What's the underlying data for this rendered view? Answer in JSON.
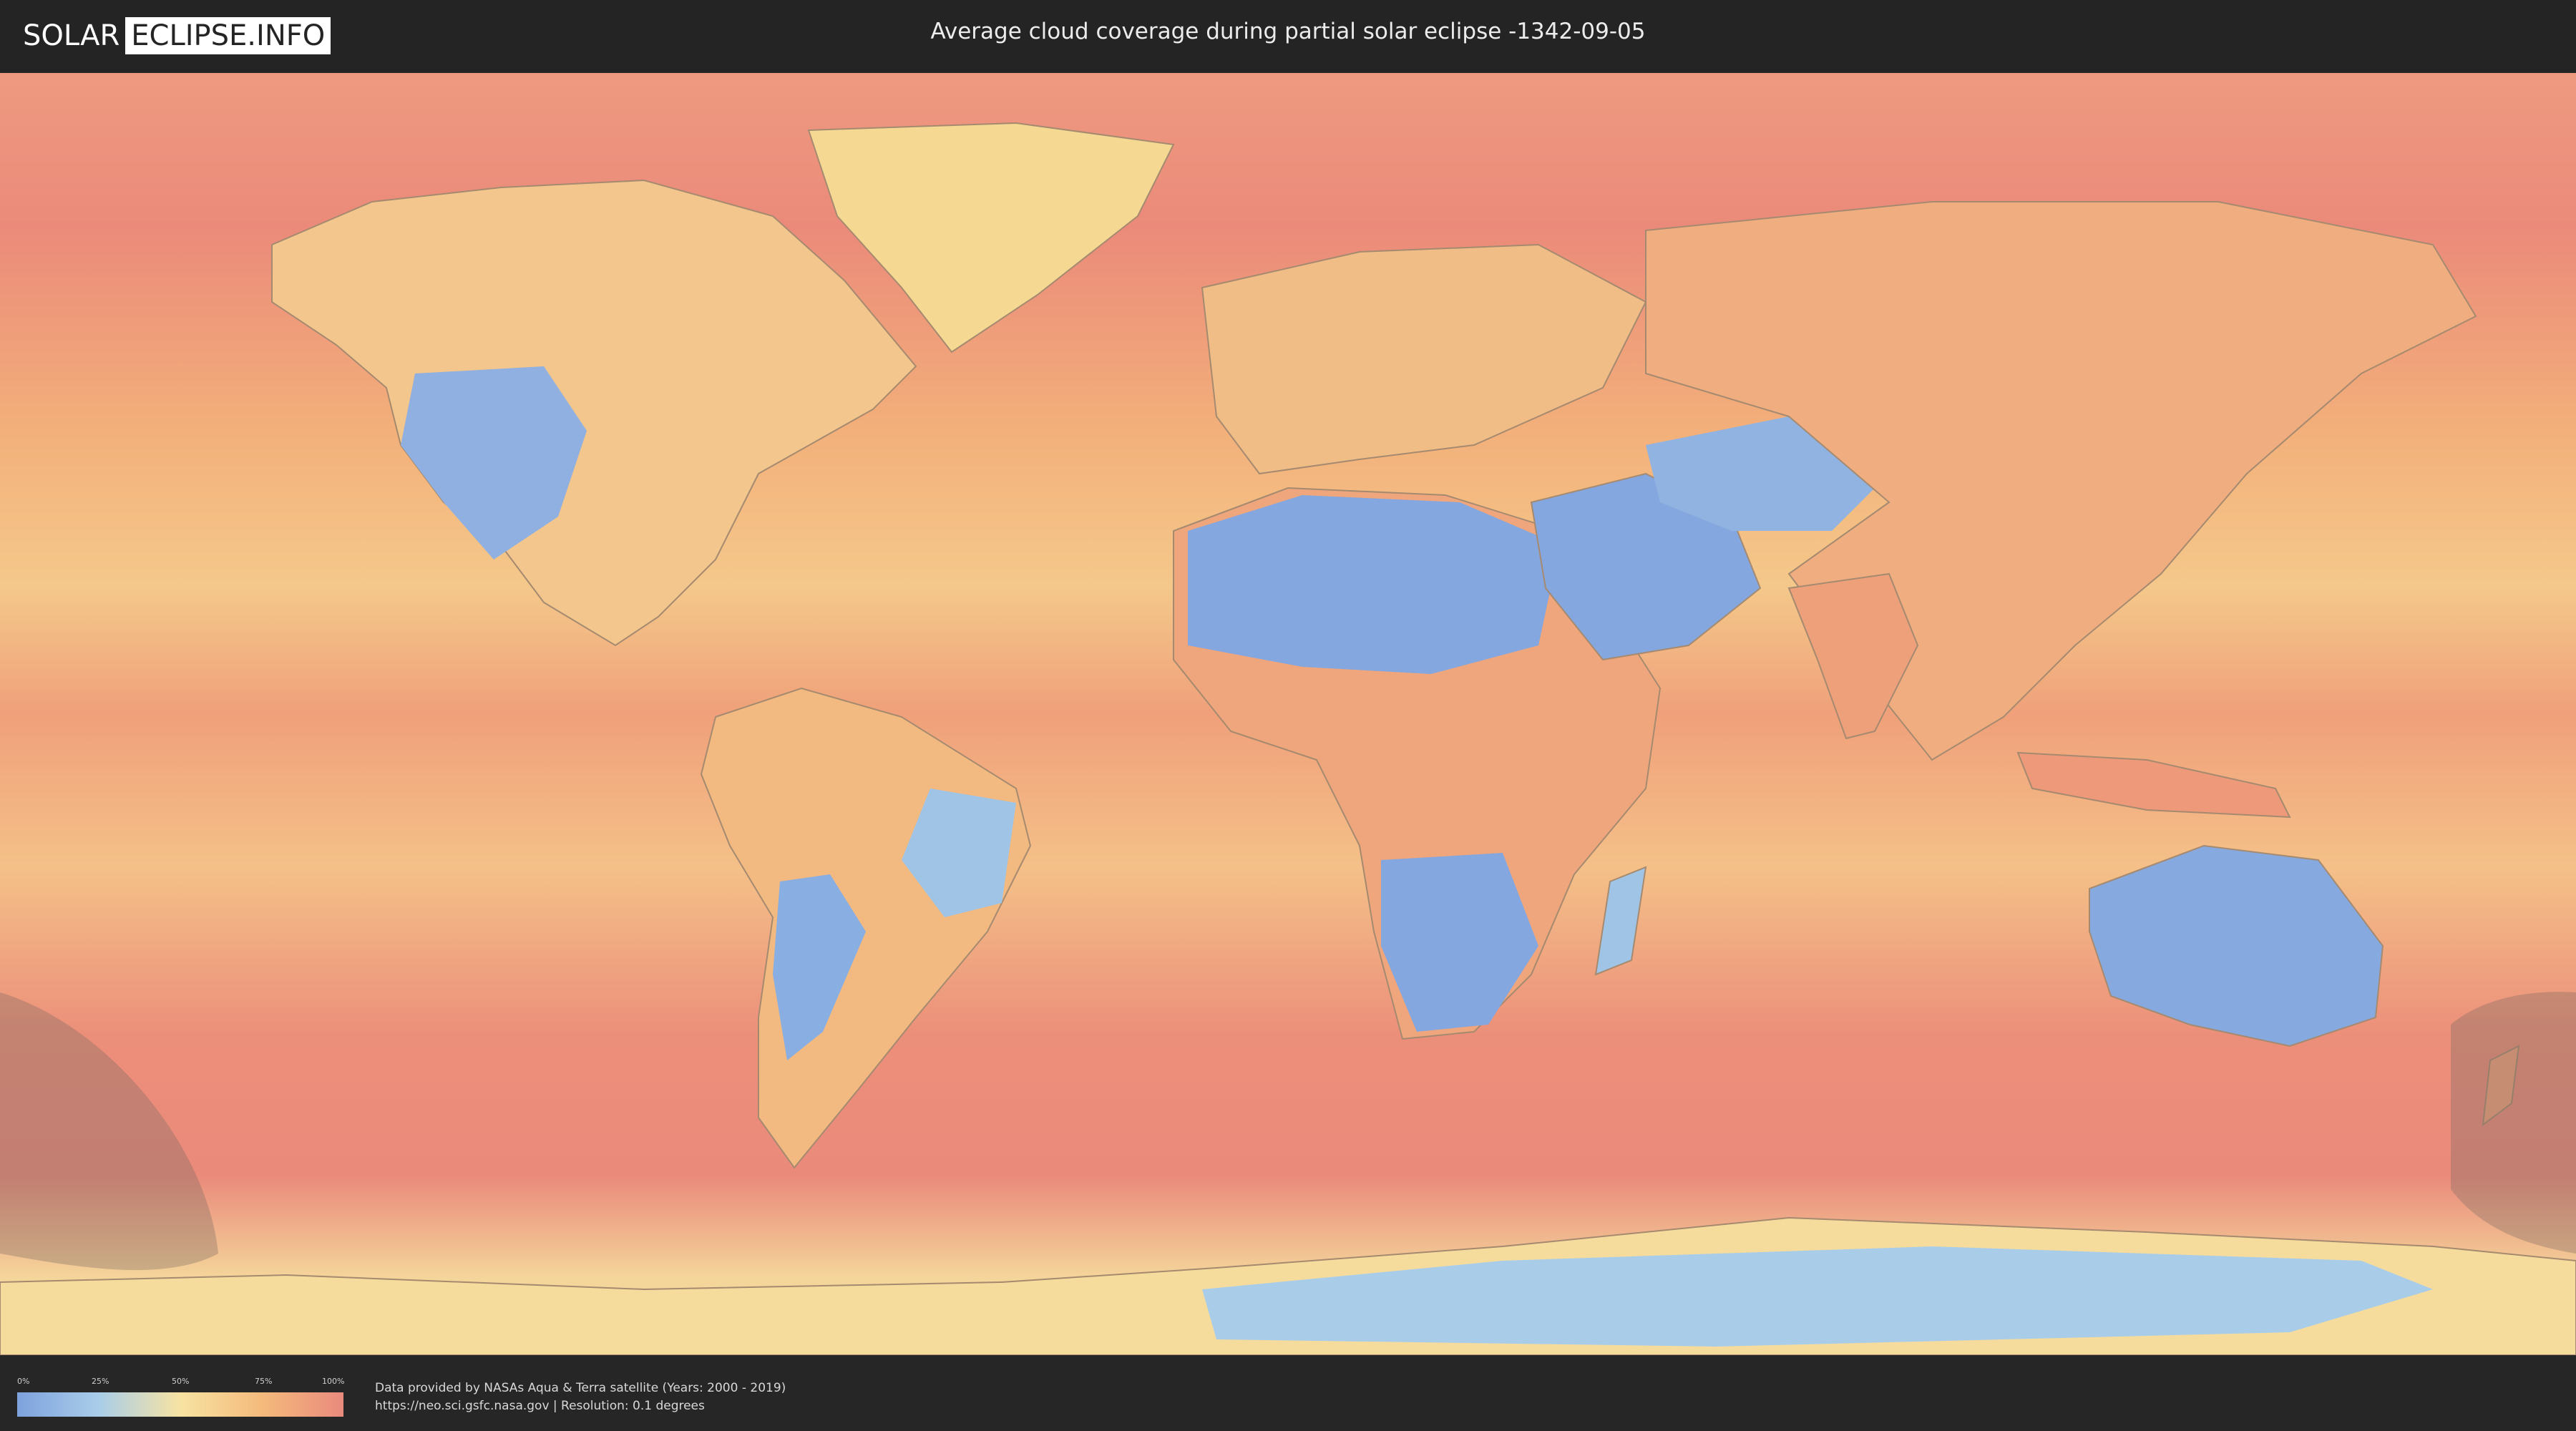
{
  "header": {
    "logo_left": "SOLAR",
    "logo_right": "ECLIPSE.INFO",
    "title": "Average cloud coverage during partial solar eclipse -1342-09-05"
  },
  "map": {
    "colors": {
      "ocean_high": "#ea8a7d",
      "mid": "#f7e3a2",
      "low": "#7ea2dd",
      "border": "#8a7d78",
      "shadow": "#7a6a62"
    }
  },
  "legend": {
    "ticks": [
      "0%",
      "25%",
      "50%",
      "75%",
      "100%"
    ],
    "tick_values": [
      0,
      25,
      50,
      75,
      100
    ],
    "gradient_colors": [
      "#7ea2dd",
      "#a9cde9",
      "#f7e3a2",
      "#f4ba7c",
      "#ea8a7d"
    ]
  },
  "credits": {
    "line1": "Data provided by NASAs Aqua & Terra satellite (Years: 2000 - 2019)",
    "line2": "https://neo.sci.gsfc.nasa.gov | Resolution: 0.1 degrees"
  }
}
